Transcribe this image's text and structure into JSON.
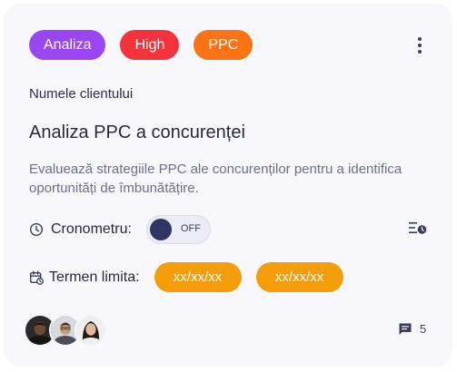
{
  "card": {
    "tags": [
      {
        "label": "Analiza",
        "color": "#9a46f3"
      },
      {
        "label": "High",
        "color": "#f4333d"
      },
      {
        "label": "PPC",
        "color": "#fb7314"
      }
    ],
    "client_name": "Numele clientului",
    "title": "Analiza PPC a concurenței",
    "description": "Evaluează strategiile PPC ale concurenților pentru a identifica oportunități de îmbunătățire.",
    "timer": {
      "label": "Cronometru:",
      "state": "OFF",
      "icon": "clock-icon"
    },
    "deadline": {
      "label": "Termen limita:",
      "start": "xx/xx/xx",
      "end": "xx/xx/xx",
      "icon": "calendar-clock-icon",
      "color": "#f59e0b"
    },
    "comments": {
      "count": "5",
      "icon": "comment-icon"
    },
    "assignees": [
      "avatar-1",
      "avatar-2",
      "avatar-3"
    ]
  }
}
